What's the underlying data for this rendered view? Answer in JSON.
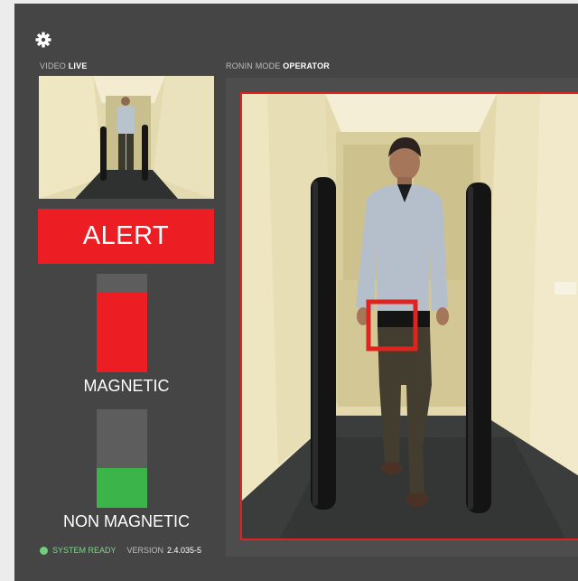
{
  "header": {
    "settings_icon": "gear-icon"
  },
  "video": {
    "label": "VIDEO",
    "value": "LIVE"
  },
  "mode": {
    "label": "RONIN MODE",
    "value": "OPERATOR"
  },
  "alert": {
    "label": "ALERT",
    "color": "#ec1e24"
  },
  "magnetic": {
    "label": "MAGNETIC",
    "level": 0.82,
    "color": "#ec1e24"
  },
  "non_magnetic": {
    "label": "NON MAGNETIC",
    "level": 0.4,
    "color": "#3bb54a"
  },
  "status": {
    "text": "SYSTEM READY",
    "version_label": "VERSION",
    "version": "2.4.035-5",
    "color": "#6fcf7a"
  },
  "detection": {
    "box_color": "#e1231f"
  }
}
